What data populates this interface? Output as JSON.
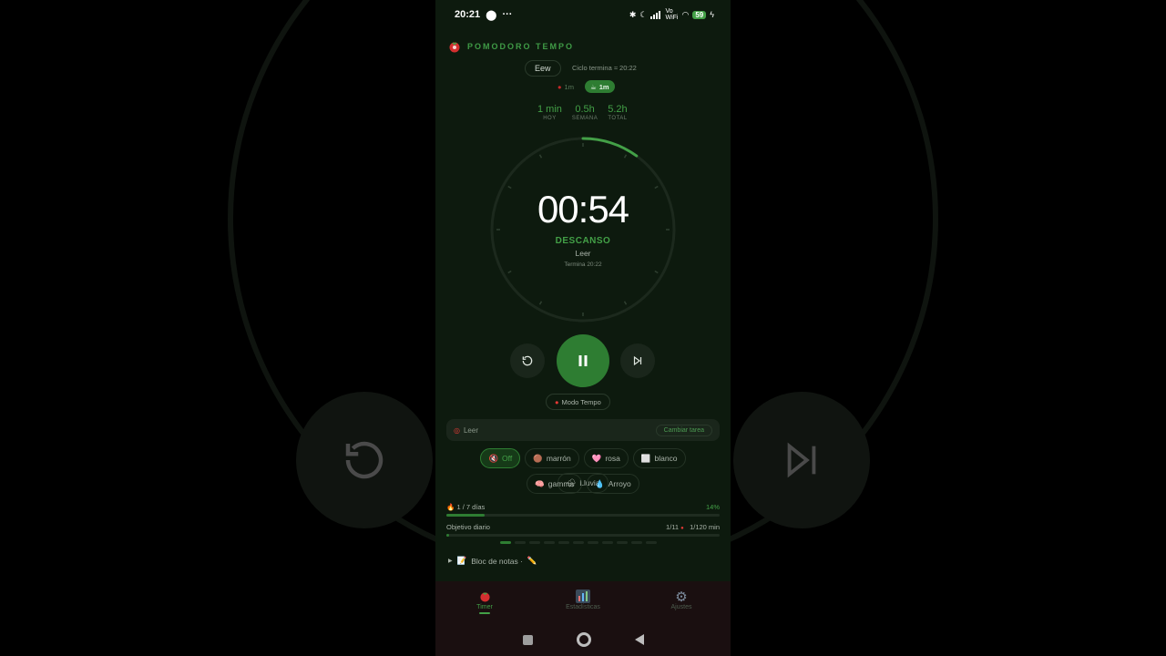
{
  "status_bar": {
    "time": "20:21",
    "network_label": "Vo\nWiFi",
    "battery": "59"
  },
  "app": {
    "title": "POMODORO TEMPO"
  },
  "session": {
    "task_pill": "Eew",
    "cycle_text": "Ciclo termina ≈ 20:22",
    "focus_chip": "1m",
    "break_chip": "1m"
  },
  "stats": [
    {
      "value": "1 min",
      "label": "HOY"
    },
    {
      "value": "0.5h",
      "label": "SEMANA"
    },
    {
      "value": "5.2h",
      "label": "TOTAL"
    }
  ],
  "timer": {
    "time": "00:54",
    "mode": "DESCANSO",
    "task": "Leer",
    "ends": "Termina 20:22",
    "progress_fraction": 0.1
  },
  "controls": {
    "tempo_mode": "Modo Tempo"
  },
  "task_bar": {
    "task": "Leer",
    "change_label": "Cambiar tarea"
  },
  "sounds": [
    {
      "label": "Off",
      "icon": "muted-speaker-icon",
      "glyph": "🔇",
      "active": true
    },
    {
      "label": "marrón",
      "icon": "brown-circle-icon",
      "glyph": "🟤",
      "active": false
    },
    {
      "label": "rosa",
      "icon": "pink-heart-icon",
      "glyph": "🩷",
      "active": false
    },
    {
      "label": "blanco",
      "icon": "white-square-icon",
      "glyph": "⬜",
      "active": false
    },
    {
      "label": "Lluvia",
      "icon": "rain-cloud-icon",
      "glyph": "🌧",
      "active": false
    },
    {
      "label": "gamma",
      "icon": "brain-icon",
      "glyph": "🧠",
      "active": false
    },
    {
      "label": "Arroyo",
      "icon": "droplet-icon",
      "glyph": "💧",
      "active": false
    }
  ],
  "streak": {
    "label": "1 / 7 días",
    "percent": "14%",
    "fraction": 0.14
  },
  "daily_goal": {
    "label": "Objetivo diario",
    "pomodoros": "1/11",
    "minutes": "1/120 min",
    "fraction": 0.01
  },
  "notes": {
    "label": "Bloc de notas ·"
  },
  "tabs": [
    {
      "label": "Timer",
      "icon": "tomato-icon",
      "active": true
    },
    {
      "label": "Estadísticas",
      "icon": "bar-chart-icon",
      "active": false
    },
    {
      "label": "Ajustes",
      "icon": "gear-icon",
      "active": false
    }
  ],
  "colors": {
    "accent": "#43a047",
    "accent_dark": "#2e7d32",
    "background": "#0d1a0e"
  }
}
